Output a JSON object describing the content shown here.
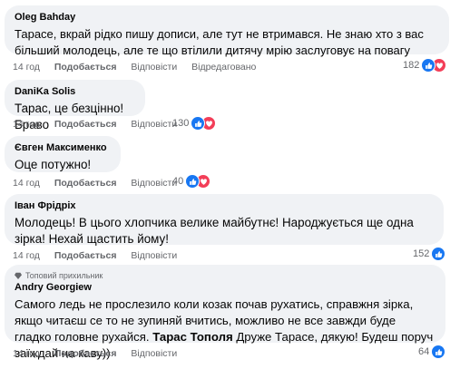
{
  "comments": [
    {
      "author": "Oleg Bahday",
      "text": "Тарасе, вкрай рідко пишу дописи, але тут не втримався. Не знаю хто з вас більший молодець, але те що втілили дитячу мрію заслуговує на повагу",
      "time": "14 год",
      "like": "Подобається",
      "reply": "Відповісти",
      "edited": "Відредаговано",
      "reactions": "182",
      "icons": [
        "like-icon",
        "heart-icon"
      ]
    },
    {
      "author": "DaniKa Solis",
      "text": "Тарас, це безцінно! Браво",
      "time": "14 год",
      "like": "Подобається",
      "reply": "Відповісти",
      "reactions": "130",
      "icons": [
        "like-icon",
        "heart-icon"
      ]
    },
    {
      "author": "Євген Максименко",
      "text": "Оце потужно!",
      "time": "14 год",
      "like": "Подобається",
      "reply": "Відповісти",
      "reactions": "40",
      "icons": [
        "like-icon",
        "heart-icon"
      ]
    },
    {
      "author": "Іван Фрідріх",
      "text": "Молодець! В цього хлопчика велике майбутнє! Народжується ще одна зірка! Нехай щастить йому!",
      "time": "14 год",
      "like": "Подобається",
      "reply": "Відповісти",
      "reactions": "152",
      "icons": [
        "like-icon"
      ]
    },
    {
      "badge": "Топовий прихильник",
      "author": "Andry Georgiew",
      "text": "Самого ледь не прослезило коли козак почав рухатись, справжня зірка, якщо читаєш се то не зупиняй вчитись, можливо не все завжди буде гладко головне рухайся.",
      "mention": "Тарас Тополя",
      "text_after": "Друже Тарасе, дякую! Будеш поруч заїждай на каву))",
      "time": "14 год",
      "like": "Подобається",
      "reply": "Відповісти",
      "reactions": "64",
      "icons": [
        "like-icon"
      ]
    }
  ],
  "colors": {
    "like": "#1877f2",
    "heart": "#f33e58",
    "bubble": "#f0f2f5",
    "meta": "#65676b"
  }
}
